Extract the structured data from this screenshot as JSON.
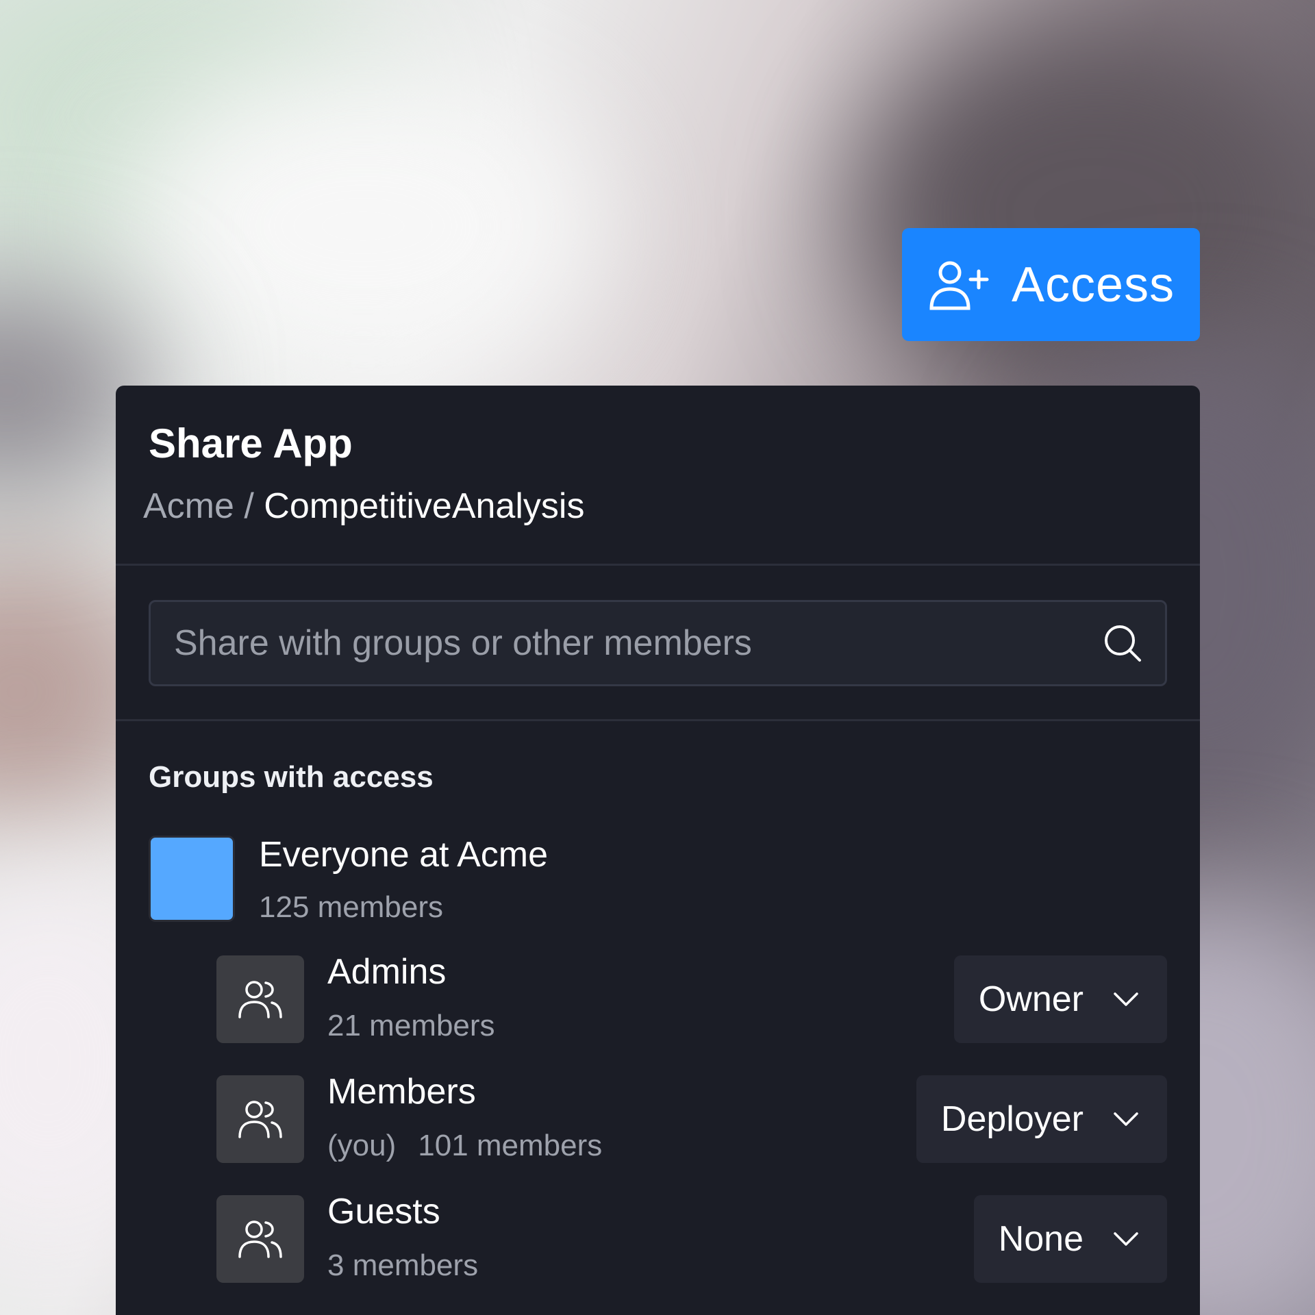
{
  "access_button": {
    "label": "Access",
    "icon": "user-plus-icon",
    "color": "#1a85ff"
  },
  "dialog": {
    "title": "Share App",
    "breadcrumb": {
      "org": "Acme",
      "separator": "/",
      "app": "CompetitiveAnalysis"
    },
    "search": {
      "placeholder": "Share with groups or other members",
      "icon": "search-icon"
    },
    "section_heading": "Groups with access",
    "parent_group": {
      "name": "Everyone at Acme",
      "count": "125 members",
      "swatch_color": "#55a8ff"
    },
    "groups": [
      {
        "name": "Admins",
        "you": "",
        "count": "21 members",
        "role": "Owner",
        "icon": "users-icon"
      },
      {
        "name": "Members",
        "you": "(you)",
        "count": "101 members",
        "role": "Deployer",
        "icon": "users-icon"
      },
      {
        "name": "Guests",
        "you": "",
        "count": "3 members",
        "role": "None",
        "icon": "users-icon"
      }
    ]
  }
}
